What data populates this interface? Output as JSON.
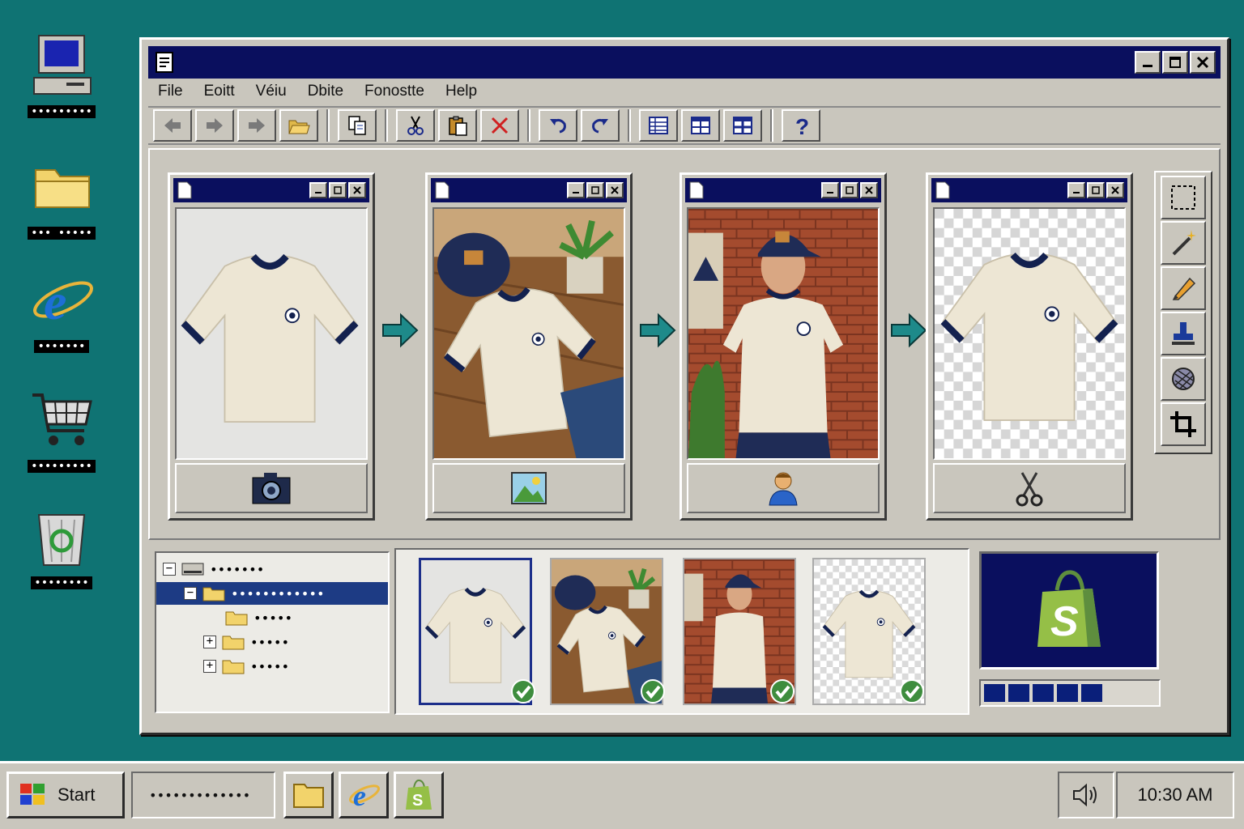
{
  "desktop": {
    "icons": [
      {
        "name": "computer-icon",
        "label": "•••••••••"
      },
      {
        "name": "folder-icon",
        "label": "••• •••••"
      },
      {
        "name": "internet-explorer-icon",
        "label": "•••••••"
      },
      {
        "name": "shopping-cart-icon",
        "label": "•••••••••"
      },
      {
        "name": "recycle-bin-icon",
        "label": "••••••••"
      }
    ]
  },
  "window": {
    "menu": [
      "File",
      "Eoitt",
      "Véiu",
      "Dbite",
      "Fonostte",
      "Help"
    ]
  },
  "pipeline": {
    "steps": [
      {
        "label": "product-photo",
        "footer_icon": "camera-icon"
      },
      {
        "label": "flat-lay-scene",
        "footer_icon": "image-icon"
      },
      {
        "label": "model-photo",
        "footer_icon": "person-icon"
      },
      {
        "label": "background-removed",
        "footer_icon": "scissors-icon"
      }
    ]
  },
  "tree": {
    "items": [
      "•••••••",
      "••••••••••••",
      "•••••",
      "•••••",
      "•••••"
    ]
  },
  "thumbnails": {
    "count": 4,
    "selected_index": 0
  },
  "upload": {
    "progress": 0.5
  },
  "taskbar": {
    "start_label": "Start",
    "task_label": "•••••••••••••",
    "clock": "10:30 AM"
  },
  "colors": {
    "desktop": "#0f7373",
    "titlebar": "#0a0f5e",
    "chrome": "#c9c6bd",
    "shopify_green": "#95bf47"
  }
}
